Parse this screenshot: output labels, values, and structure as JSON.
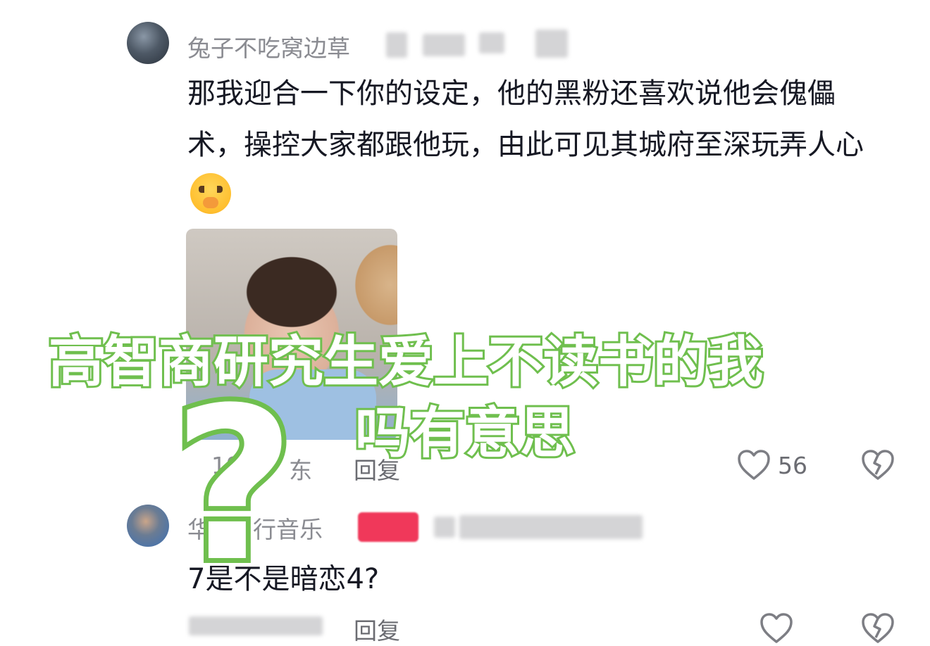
{
  "comments": [
    {
      "username": "兔子不吃窝边草",
      "text": "那我迎合一下你的设定，他的黑粉还喜欢说他会傀儡术，操控大家都跟他玩，由此可见其城府至深玩弄人心",
      "meta": "19",
      "meta_suffix": "东",
      "reply_label": "回复",
      "likes": "56"
    },
    {
      "username": "华",
      "username_rest": "行音乐",
      "text": "7是不是暗恋4?",
      "reply_label": "回复"
    }
  ],
  "overlay": {
    "line1": "高智商研究生爱上不读书的我",
    "line2": "吗有意思",
    "question": "?"
  },
  "colors": {
    "overlay_stroke": "#6fbf4e",
    "text": "#161823",
    "meta": "#8a8b91"
  }
}
